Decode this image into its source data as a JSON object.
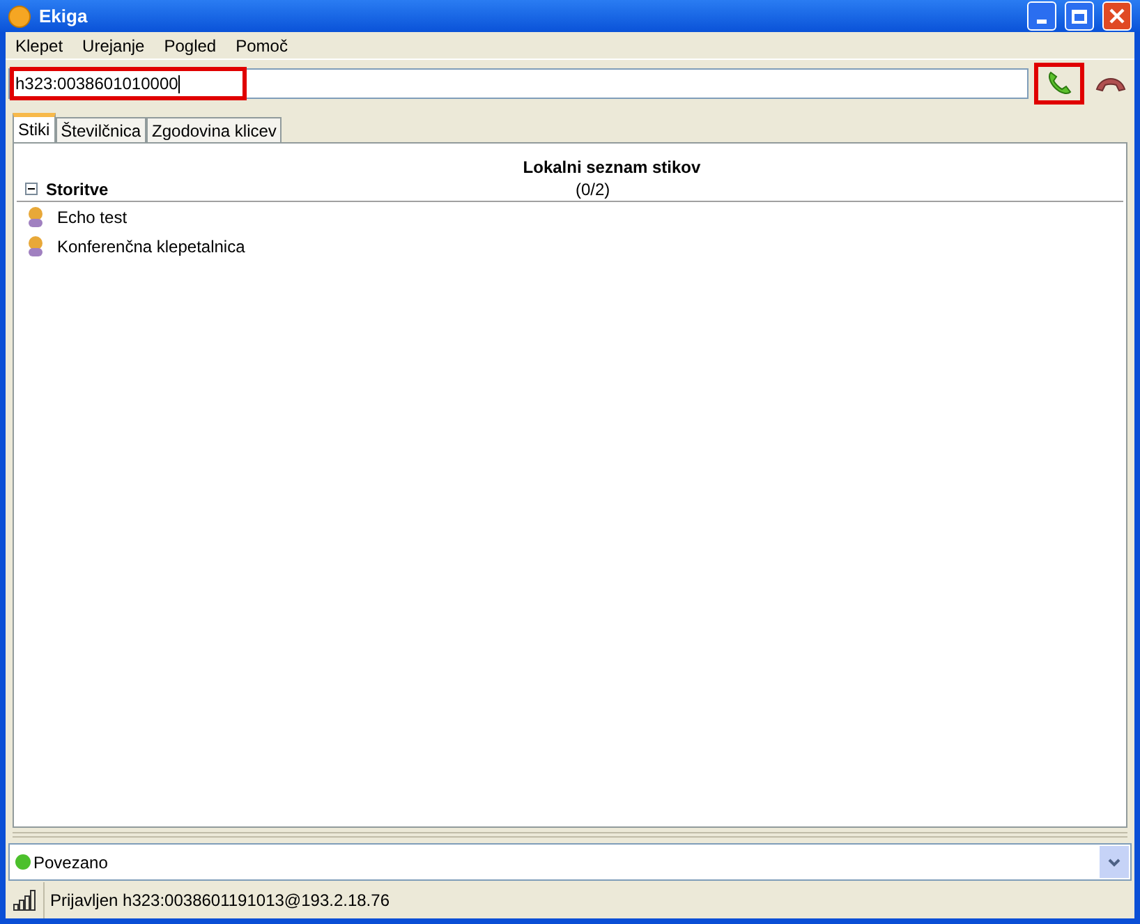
{
  "window": {
    "title": "Ekiga"
  },
  "menu": [
    "Klepet",
    "Urejanje",
    "Pogled",
    "Pomoč"
  ],
  "address": {
    "value": "h323:0038601010000",
    "highlighted": true
  },
  "call_button": {
    "highlighted": true
  },
  "tabs": [
    {
      "label": "Stiki",
      "selected": true
    },
    {
      "label": "Številčnica",
      "selected": false
    },
    {
      "label": "Zgodovina klicev",
      "selected": false
    }
  ],
  "roster": {
    "title": "Lokalni seznam stikov",
    "group": {
      "name": "Storitve",
      "count": "(0/2)",
      "expanded": true,
      "contacts": [
        "Echo test",
        "Konferenčna klepetalnica"
      ]
    }
  },
  "presence": {
    "label": "Povezano",
    "color": "#4cc02c"
  },
  "status_bar": "Prijavljen h323:0038601191013@193.2.18.76"
}
